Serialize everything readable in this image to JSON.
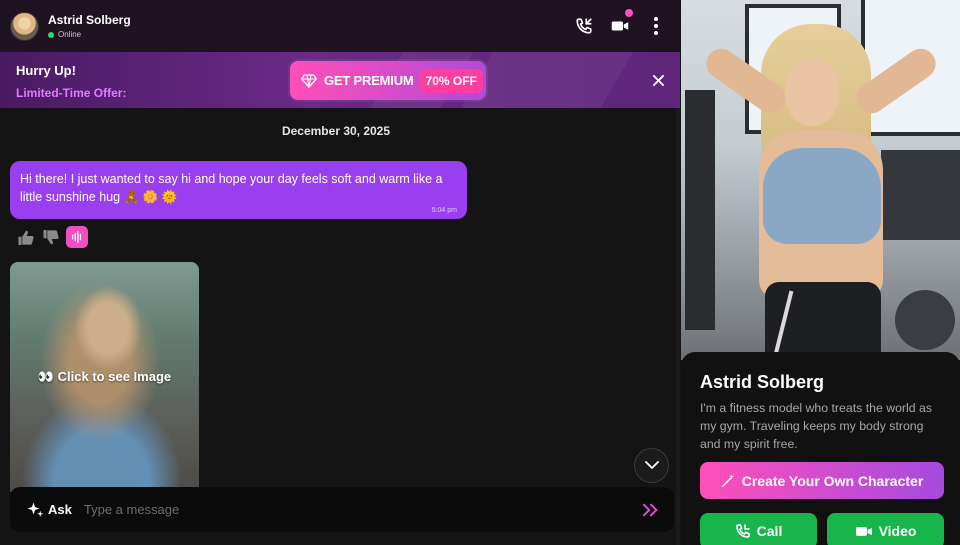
{
  "header": {
    "name": "Astrid Solberg",
    "status": "Online"
  },
  "promo": {
    "title": "Hurry Up!",
    "subtitle": "Limited-Time Offer:",
    "premium_label": "GET PREMIUM",
    "discount": "70% OFF"
  },
  "chat": {
    "date": "December 30, 2025",
    "message": {
      "text": "Hi there! I just wanted to say hi and hope your day feels soft and warm like a little sunshine hug 🧸 🌼 🌞",
      "time": "5:04 pm"
    },
    "locked_image_label": "👀 Click to see Image"
  },
  "composer": {
    "ask_label": "Ask",
    "placeholder": "Type a message"
  },
  "profile": {
    "name": "Astrid Solberg",
    "bio": "I'm a fitness model who treats the world as my gym. Traveling keeps my body strong and my spirit free.",
    "create_label": "Create Your Own Character",
    "call_label": "Call",
    "video_label": "Video"
  },
  "colors": {
    "accent_purple": "#9a3ff0",
    "accent_pink": "#ff4fb8",
    "call_green": "#17b54a",
    "online_green": "#2ed66b"
  }
}
